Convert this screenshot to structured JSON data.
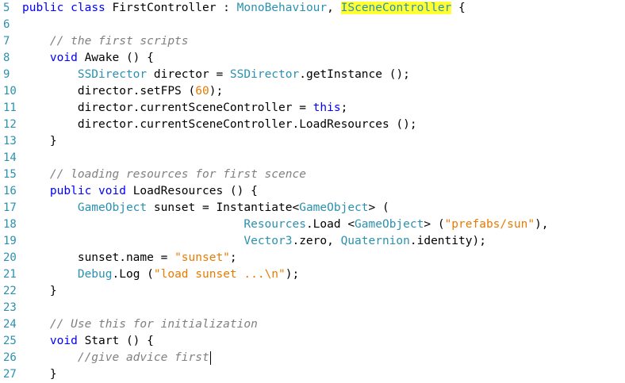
{
  "lines": [
    {
      "num": "5",
      "segs": [
        [
          "kw",
          "public"
        ],
        [
          "",
          " "
        ],
        [
          "kw",
          "class"
        ],
        [
          "",
          " FirstController : "
        ],
        [
          "ty",
          "MonoBehaviour"
        ],
        [
          "",
          ", "
        ],
        [
          "ty hl",
          "ISceneController"
        ],
        [
          "",
          " {"
        ]
      ]
    },
    {
      "num": "6",
      "segs": []
    },
    {
      "num": "7",
      "segs": [
        [
          "",
          "    "
        ],
        [
          "cm",
          "// the first scripts"
        ]
      ]
    },
    {
      "num": "8",
      "segs": [
        [
          "",
          "    "
        ],
        [
          "kw",
          "void"
        ],
        [
          "",
          " Awake () {"
        ]
      ]
    },
    {
      "num": "9",
      "segs": [
        [
          "",
          "        "
        ],
        [
          "ty",
          "SSDirector"
        ],
        [
          "",
          " director = "
        ],
        [
          "ty",
          "SSDirector"
        ],
        [
          "",
          ".getInstance ();"
        ]
      ]
    },
    {
      "num": "10",
      "segs": [
        [
          "",
          "        director.setFPS ("
        ],
        [
          "nu",
          "60"
        ],
        [
          "",
          ");"
        ]
      ]
    },
    {
      "num": "11",
      "segs": [
        [
          "",
          "        director.currentSceneController = "
        ],
        [
          "kw",
          "this"
        ],
        [
          "",
          ";"
        ]
      ]
    },
    {
      "num": "12",
      "segs": [
        [
          "",
          "        director.currentSceneController.LoadResources ();"
        ]
      ]
    },
    {
      "num": "13",
      "segs": [
        [
          "",
          "    }"
        ]
      ]
    },
    {
      "num": "14",
      "segs": []
    },
    {
      "num": "15",
      "segs": [
        [
          "",
          "    "
        ],
        [
          "cm",
          "// loading resources for first scence"
        ]
      ]
    },
    {
      "num": "16",
      "segs": [
        [
          "",
          "    "
        ],
        [
          "kw",
          "public"
        ],
        [
          "",
          " "
        ],
        [
          "kw",
          "void"
        ],
        [
          "",
          " LoadResources () {"
        ]
      ]
    },
    {
      "num": "17",
      "segs": [
        [
          "",
          "        "
        ],
        [
          "ty",
          "GameObject"
        ],
        [
          "",
          " sunset = Instantiate<"
        ],
        [
          "ty",
          "GameObject"
        ],
        [
          "",
          "> ("
        ]
      ]
    },
    {
      "num": "18",
      "segs": [
        [
          "",
          "                                "
        ],
        [
          "ty",
          "Resources"
        ],
        [
          "",
          ".Load <"
        ],
        [
          "ty",
          "GameObject"
        ],
        [
          "",
          "> ("
        ],
        [
          "st",
          "\"prefabs/sun\""
        ],
        [
          "",
          "),"
        ]
      ]
    },
    {
      "num": "19",
      "segs": [
        [
          "",
          "                                "
        ],
        [
          "ty",
          "Vector3"
        ],
        [
          "",
          ".zero, "
        ],
        [
          "ty",
          "Quaternion"
        ],
        [
          "",
          ".identity);"
        ]
      ]
    },
    {
      "num": "20",
      "segs": [
        [
          "",
          "        sunset.name = "
        ],
        [
          "st",
          "\"sunset\""
        ],
        [
          "",
          ";"
        ]
      ]
    },
    {
      "num": "21",
      "segs": [
        [
          "",
          "        "
        ],
        [
          "ty",
          "Debug"
        ],
        [
          "",
          ".Log ("
        ],
        [
          "st",
          "\"load sunset ...\\n\""
        ],
        [
          "",
          ");"
        ]
      ]
    },
    {
      "num": "22",
      "segs": [
        [
          "",
          "    }"
        ]
      ]
    },
    {
      "num": "23",
      "segs": []
    },
    {
      "num": "24",
      "segs": [
        [
          "",
          "    "
        ],
        [
          "cm",
          "// Use this for initialization"
        ]
      ]
    },
    {
      "num": "25",
      "segs": [
        [
          "",
          "    "
        ],
        [
          "kw",
          "void"
        ],
        [
          "",
          " Start () {"
        ]
      ]
    },
    {
      "num": "26",
      "segs": [
        [
          "",
          "        "
        ],
        [
          "cm",
          "//give advice first"
        ]
      ],
      "caret": true
    },
    {
      "num": "27",
      "segs": [
        [
          "",
          "    }"
        ]
      ]
    }
  ]
}
